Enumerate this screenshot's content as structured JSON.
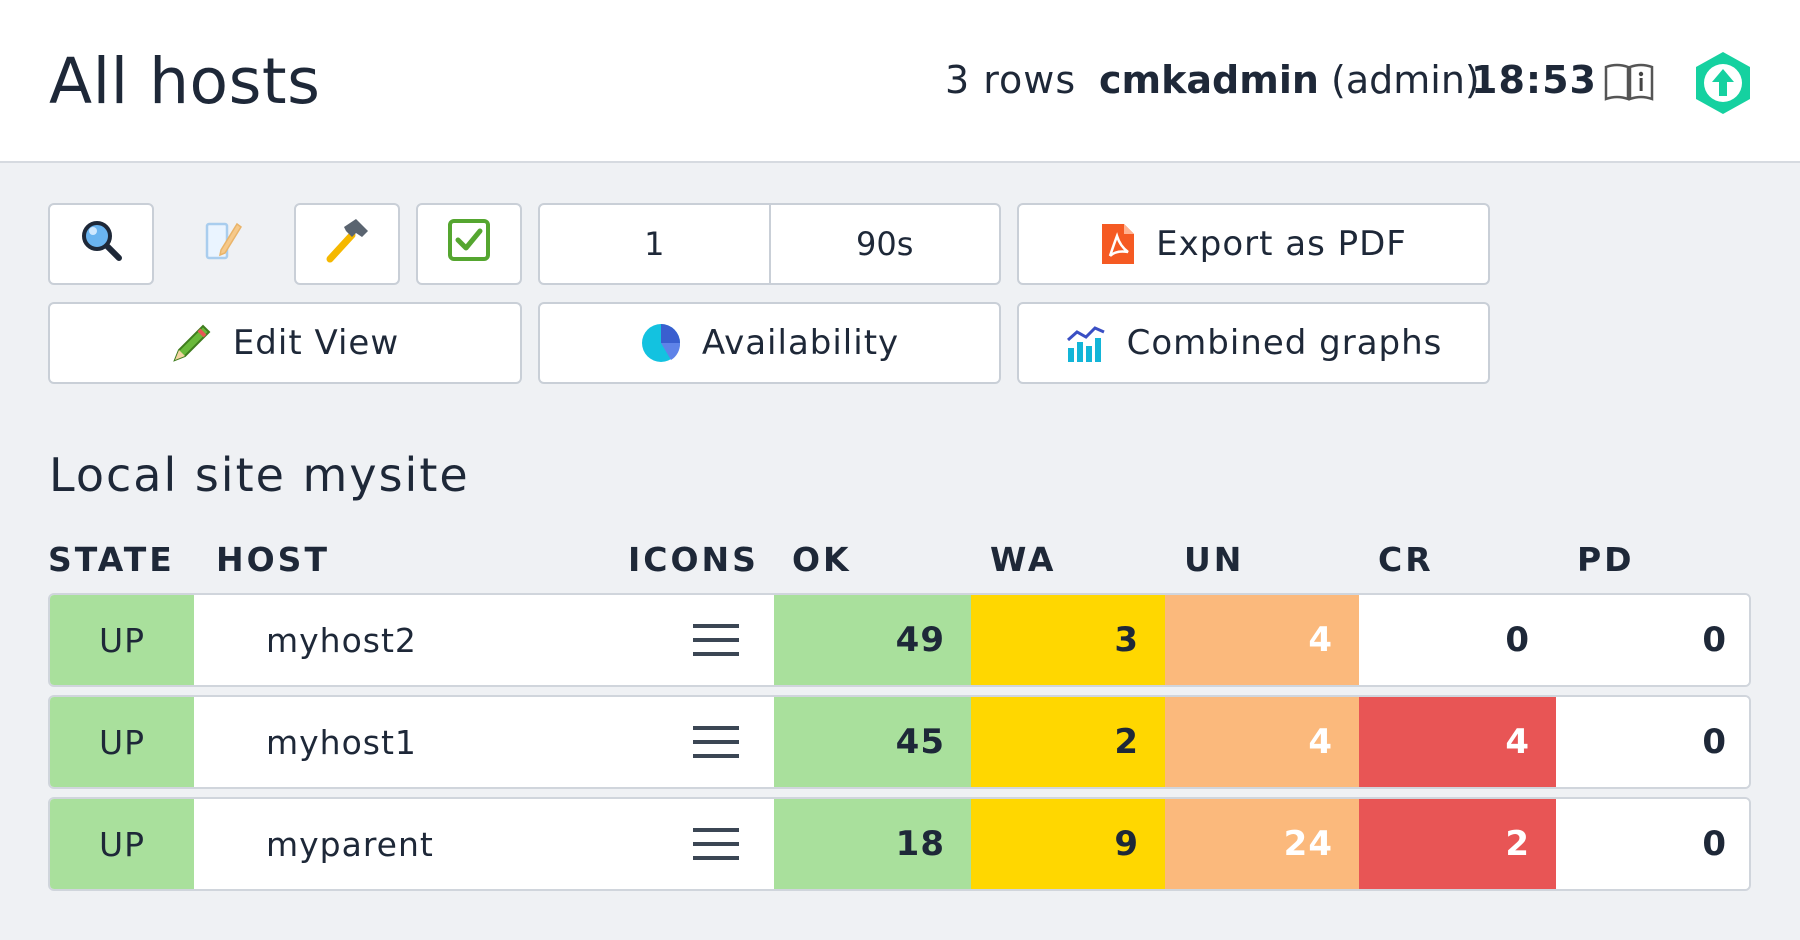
{
  "header": {
    "title": "All hosts",
    "row_count": "3 rows",
    "user": "cmkadmin",
    "role": "(admin)",
    "time": "18:53"
  },
  "toolbar": {
    "reload_count": "1",
    "reload_interval": "90s",
    "export_pdf": "Export as PDF",
    "edit_view": "Edit View",
    "availability": "Availability",
    "combined_graphs": "Combined graphs"
  },
  "section": {
    "title": "Local site mysite"
  },
  "table": {
    "columns": [
      "STATE",
      "HOST",
      "ICONS",
      "OK",
      "WA",
      "UN",
      "CR",
      "PD"
    ],
    "rows": [
      {
        "state": "UP",
        "host": "myhost2",
        "ok": "49",
        "wa": "3",
        "un": "4",
        "cr": "0",
        "pd": "0"
      },
      {
        "state": "UP",
        "host": "myhost1",
        "ok": "45",
        "wa": "2",
        "un": "4",
        "cr": "4",
        "pd": "0"
      },
      {
        "state": "UP",
        "host": "myparent",
        "ok": "18",
        "wa": "9",
        "un": "24",
        "cr": "2",
        "pd": "0"
      }
    ]
  },
  "colors": {
    "ok": "#a9e09c",
    "warn": "#ffd700",
    "unknown": "#fbb97c",
    "crit": "#e85555",
    "brand": "#15d1a0"
  },
  "icons": [
    "search-icon",
    "pencil-page-icon",
    "hammer-icon",
    "checkbox-icon",
    "pdf-icon",
    "pencil-icon",
    "pie-chart-icon",
    "graph-icon",
    "book-icon",
    "checkmk-logo",
    "menu-icon"
  ]
}
